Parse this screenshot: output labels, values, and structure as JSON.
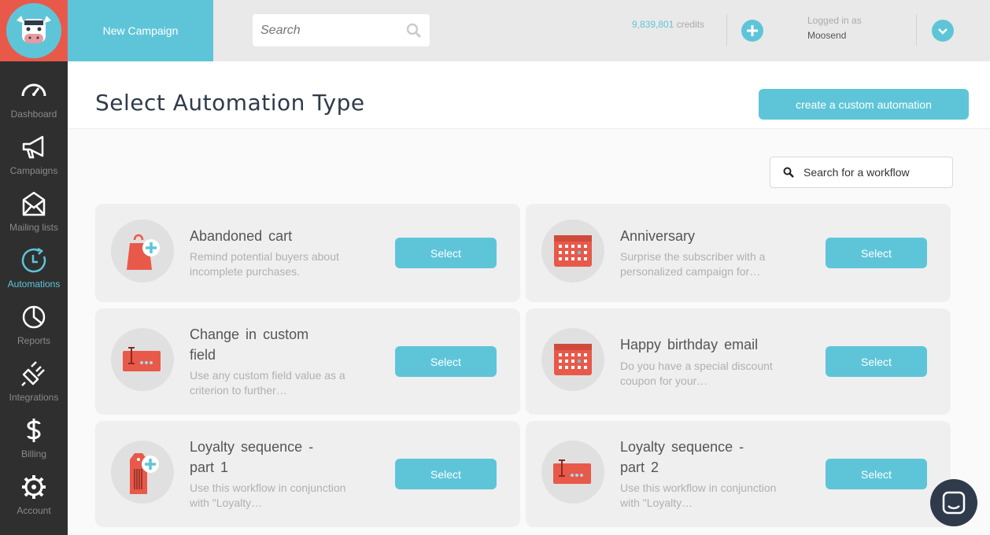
{
  "topbar": {
    "new_campaign_label": "New Campaign",
    "search_placeholder": "Search",
    "credits_value": "9,839,801",
    "credits_unit": "credits",
    "logged_in_label": "Logged in as",
    "username": "Moosend"
  },
  "sidebar": {
    "items": [
      {
        "label": "Dashboard",
        "icon": "dashboard-icon"
      },
      {
        "label": "Campaigns",
        "icon": "megaphone-icon"
      },
      {
        "label": "Mailing lists",
        "icon": "envelope-icon"
      },
      {
        "label": "Automations",
        "icon": "clock-icon",
        "active": true
      },
      {
        "label": "Reports",
        "icon": "pie-chart-icon"
      },
      {
        "label": "Integrations",
        "icon": "plug-icon"
      },
      {
        "label": "Billing",
        "icon": "dollar-icon"
      },
      {
        "label": "Account",
        "icon": "gear-icon"
      }
    ]
  },
  "header": {
    "title": "Select Automation Type",
    "custom_button": "create a custom automation"
  },
  "workflow_search": {
    "placeholder": "Search for a workflow"
  },
  "cards": [
    {
      "title": "Abandoned  cart",
      "desc": "Remind potential buyers about incomplete purchases.",
      "button": "Select",
      "icon": "shopping-bag-icon"
    },
    {
      "title": "Anniversary",
      "desc": "Surprise the subscriber with a personalized campaign for…",
      "button": "Select",
      "icon": "calendar-icon"
    },
    {
      "title": "Change  in  custom field",
      "desc": "Use any custom field value as a criterion to further…",
      "button": "Select",
      "icon": "input-field-icon"
    },
    {
      "title": "Happy  birthday  email",
      "desc": "Do you have a special discount coupon for your…",
      "button": "Select",
      "icon": "calendar-icon"
    },
    {
      "title": "Loyalty  sequence  - part 1",
      "desc": "Use this workflow in conjunction with \"Loyalty…",
      "button": "Select",
      "icon": "tag-plus-icon"
    },
    {
      "title": "Loyalty  sequence  - part 2",
      "desc": "Use this workflow in conjunction with \"Loyalty…",
      "button": "Select",
      "icon": "input-field-icon"
    }
  ],
  "colors": {
    "accent": "#5ec5d9",
    "brand_red": "#e8594a",
    "sidebar_bg": "#2f2f2f"
  }
}
